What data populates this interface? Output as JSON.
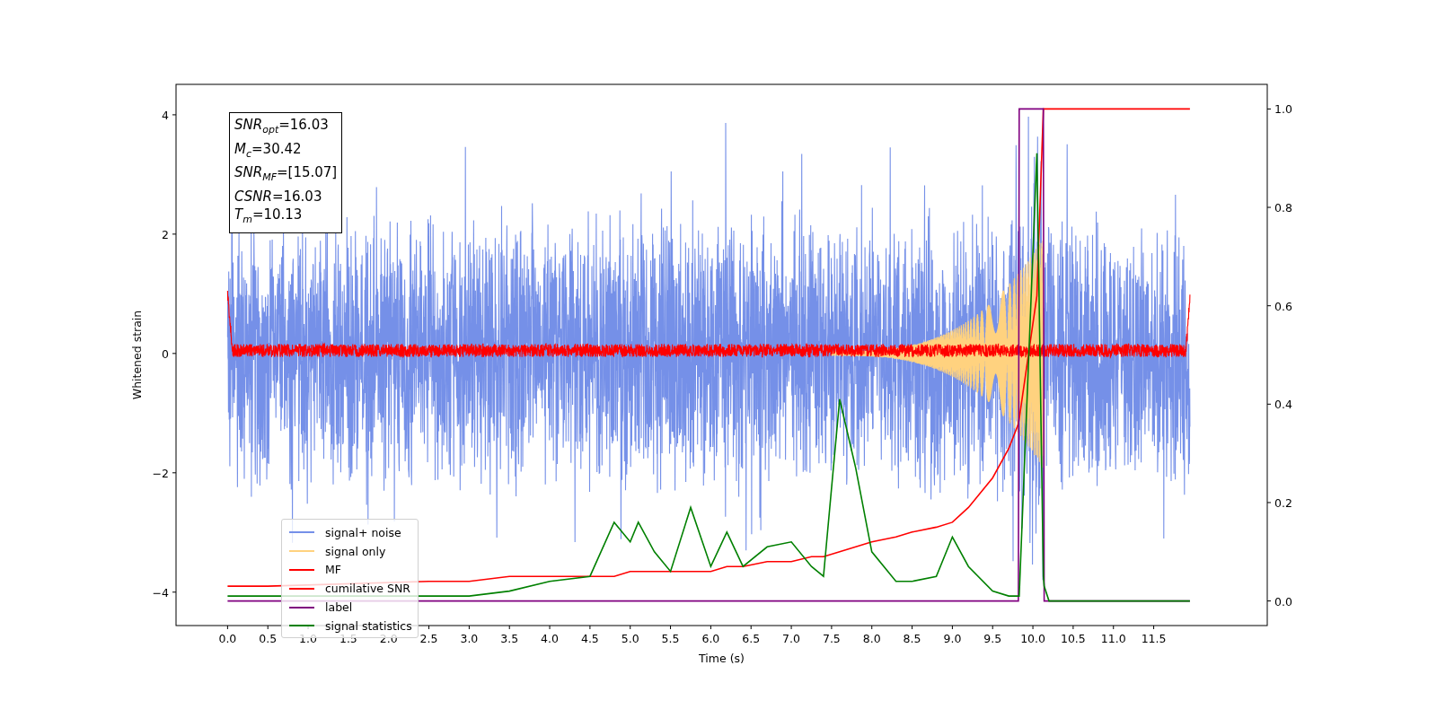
{
  "figure": {
    "info_box": {
      "lines": [
        "*SNR*$_{opt}$=16.03",
        "*M*$_{c}$=30.42",
        "*SNR*$_{MF}$=[15.07]",
        "*CSNR*=16.03",
        "*T*$_{m}$=10.13"
      ]
    },
    "traces": [
      {
        "name": "signal+ noise",
        "kind": "noise",
        "color": "#7590e8"
      },
      {
        "name": "signal only",
        "kind": "chirp",
        "color": "#ffd27f"
      },
      {
        "name": "MF",
        "kind": "filter-output",
        "color": "#ff0000"
      }
    ],
    "chart_data": {
      "type": "line",
      "xlabel": "Time (s)",
      "ylabel": "Whitened strain",
      "xlim": [
        -0.64,
        12.91
      ],
      "ylim": [
        -4.56,
        4.51
      ],
      "xticks": [
        {
          "value": 0,
          "label": "0.0"
        },
        {
          "value": 0.5,
          "label": "0.5"
        },
        {
          "value": 1,
          "label": "1.0"
        },
        {
          "value": 1.5,
          "label": "1.5"
        },
        {
          "value": 2,
          "label": "2.0"
        },
        {
          "value": 2.5,
          "label": "2.5"
        },
        {
          "value": 3,
          "label": "3.0"
        },
        {
          "value": 3.5,
          "label": "3.5"
        },
        {
          "value": 4,
          "label": "4.0"
        },
        {
          "value": 4.5,
          "label": "4.5"
        },
        {
          "value": 5,
          "label": "5.0"
        },
        {
          "value": 5.5,
          "label": "5.5"
        },
        {
          "value": 6,
          "label": "6.0"
        },
        {
          "value": 6.5,
          "label": "6.5"
        },
        {
          "value": 7,
          "label": "7.0"
        },
        {
          "value": 7.5,
          "label": "7.5"
        },
        {
          "value": 8,
          "label": "8.0"
        },
        {
          "value": 8.5,
          "label": "8.5"
        },
        {
          "value": 9,
          "label": "9.0"
        },
        {
          "value": 9.5,
          "label": "9.5"
        },
        {
          "value": 10,
          "label": "10.0"
        },
        {
          "value": 10.5,
          "label": "10.5"
        },
        {
          "value": 11,
          "label": "11.0"
        },
        {
          "value": 11.5,
          "label": "11.5"
        }
      ],
      "yticks": [
        {
          "value": -4,
          "label": "−4"
        },
        {
          "value": -2,
          "label": "−2"
        },
        {
          "value": 0,
          "label": "0"
        },
        {
          "value": 2,
          "label": "2"
        },
        {
          "value": 4,
          "label": "4"
        }
      ],
      "y2lim": [
        -0.05,
        1.05
      ],
      "legend": true,
      "y2ticks": [
        {
          "value": 0,
          "label": "0.0"
        },
        {
          "value": 0.2,
          "label": "0.2"
        },
        {
          "value": 0.4,
          "label": "0.4"
        },
        {
          "value": 0.6,
          "label": "0.6"
        },
        {
          "value": 0.8,
          "label": "0.8"
        },
        {
          "value": 1,
          "label": "1.0"
        }
      ],
      "x": [
        0,
        0.5,
        2.5,
        3,
        3.5,
        4,
        4.5,
        4.8,
        5.0,
        5.1,
        5.3,
        5.5,
        5.75,
        6.0,
        6.2,
        6.4,
        6.7,
        7.0,
        7.25,
        7.4,
        7.6,
        7.8,
        8.0,
        8.3,
        8.5,
        8.8,
        9.0,
        9.2,
        9.5,
        9.7,
        9.82,
        9.83,
        10.05,
        10.13,
        10.14,
        10.2,
        11.95
      ],
      "series": [
        {
          "name": "cumilative SNR",
          "axis": "y2",
          "color": "#ff0000",
          "values": [
            0.03,
            0.03,
            0.04,
            0.04,
            0.05,
            0.05,
            0.05,
            0.05,
            0.06,
            0.06,
            0.06,
            0.06,
            0.06,
            0.06,
            0.07,
            0.07,
            0.08,
            0.08,
            0.09,
            0.09,
            0.1,
            0.11,
            0.12,
            0.13,
            0.14,
            0.15,
            0.16,
            0.19,
            0.25,
            0.31,
            0.36,
            0.37,
            0.62,
            1.0,
            1.0,
            1.0,
            1.0
          ]
        },
        {
          "name": "label",
          "axis": "y2",
          "color": "#800080",
          "values": [
            0,
            0,
            0,
            0,
            0,
            0,
            0,
            0,
            0,
            0,
            0,
            0,
            0,
            0,
            0,
            0,
            0,
            0,
            0,
            0,
            0,
            0,
            0,
            0,
            0,
            0,
            0,
            0,
            0,
            0,
            0,
            1,
            1,
            1,
            0,
            0,
            0
          ]
        },
        {
          "name": "signal statistics",
          "axis": "y2",
          "color": "#008000",
          "values": [
            0.01,
            0.01,
            0.01,
            0.01,
            0.02,
            0.04,
            0.05,
            0.16,
            0.12,
            0.16,
            0.1,
            0.06,
            0.19,
            0.07,
            0.14,
            0.07,
            0.11,
            0.12,
            0.07,
            0.05,
            0.41,
            0.27,
            0.1,
            0.04,
            0.04,
            0.05,
            0.13,
            0.07,
            0.02,
            0.01,
            0.01,
            0.01,
            0.91,
            0.05,
            0.03,
            0,
            0
          ]
        }
      ]
    }
  }
}
